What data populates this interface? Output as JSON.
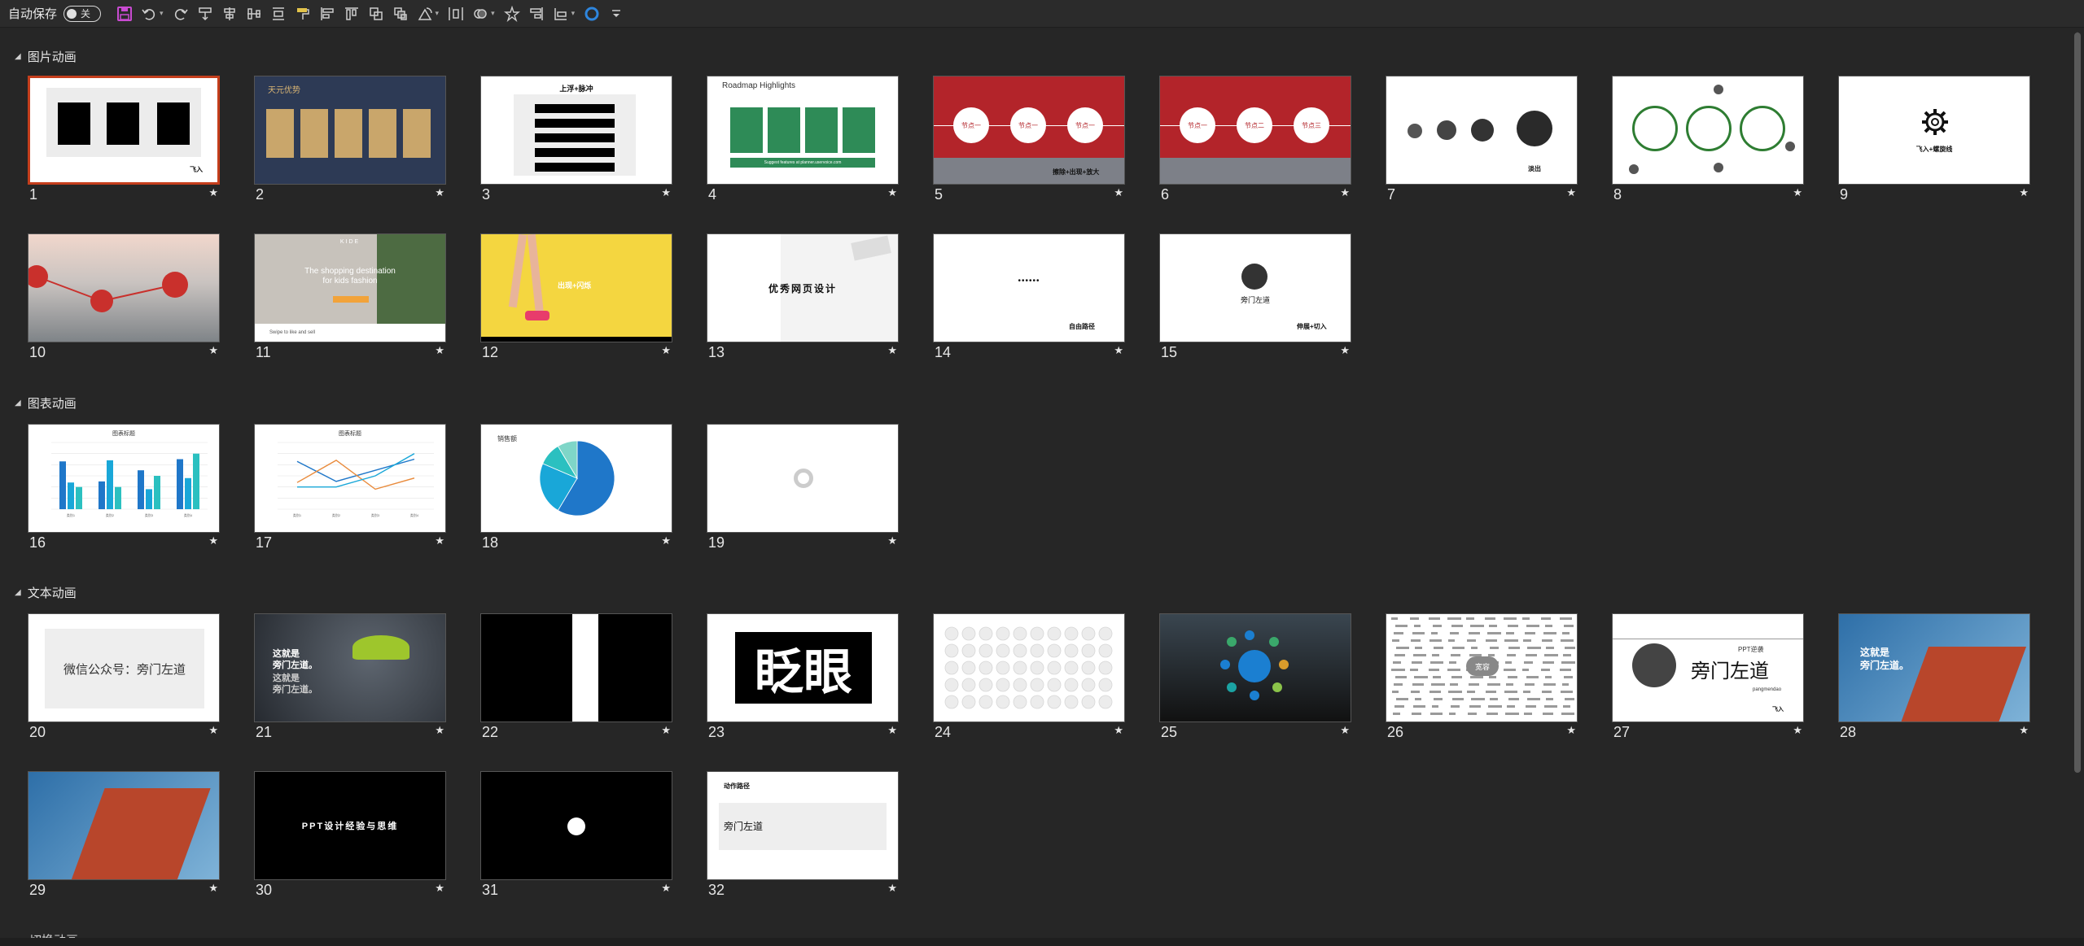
{
  "toolbar": {
    "autosave_label": "自动保存",
    "autosave_state": "关",
    "icons": [
      "save-icon",
      "undo-icon",
      "redo-icon",
      "align-icon",
      "align-center-icon",
      "distribute-icon",
      "align-middle-icon",
      "format-painter-icon",
      "align-left-icon",
      "align-top-icon",
      "group-icon",
      "arrange-icon",
      "rotate-icon",
      "distribute-horizontal-icon",
      "shapes-icon",
      "effects-icon",
      "align-right-icon",
      "align-bottom-icon",
      "color-circle-icon",
      "customize-icon"
    ]
  },
  "sections": [
    {
      "title": "图片动画"
    },
    {
      "title": "图表动画"
    },
    {
      "title": "文本动画"
    }
  ],
  "next_section": "切换动画",
  "slides": {
    "s1": {
      "num": "1",
      "caption": "飞入"
    },
    "s2": {
      "num": "2",
      "title": "天元优势"
    },
    "s3": {
      "num": "3",
      "title": "上浮+脉冲"
    },
    "s4": {
      "num": "4",
      "title": "Roadmap Highlights",
      "footer": "Suggest features at planner.uservoice.com"
    },
    "s5": {
      "num": "5",
      "n1": "节点一",
      "n2": "节点一",
      "n3": "节点一",
      "caption": "擦除+出现+放大"
    },
    "s6": {
      "num": "6",
      "n1": "节点一",
      "n2": "节点二",
      "n3": "节点三"
    },
    "s7": {
      "num": "7",
      "caption": "淡出"
    },
    "s8": {
      "num": "8"
    },
    "s9": {
      "num": "9",
      "caption": "飞入+螺旋线"
    },
    "s10": {
      "num": "10"
    },
    "s11": {
      "num": "11",
      "brand": "KIDE",
      "headline1": "The shopping destination",
      "headline2": "for kids fashion",
      "footer": "Swipe to like and sell"
    },
    "s12": {
      "num": "12",
      "caption": "出现+闪烁"
    },
    "s13": {
      "num": "13",
      "title": "优秀网页设计"
    },
    "s14": {
      "num": "14",
      "dots": "••••••",
      "caption": "自由路径"
    },
    "s15": {
      "num": "15",
      "name": "旁门左道",
      "caption": "伸展+切入"
    },
    "s16": {
      "num": "16",
      "title": "图表标题"
    },
    "s17": {
      "num": "17",
      "title": "图表标题"
    },
    "s18": {
      "num": "18",
      "title": "销售额"
    },
    "s19": {
      "num": "19"
    },
    "s20": {
      "num": "20",
      "text": "微信公众号：旁门左道"
    },
    "s21": {
      "num": "21",
      "l1": "这就是",
      "l2": "旁门左道。",
      "l3": "这就是",
      "l4": "旁门左道。"
    },
    "s22": {
      "num": "22"
    },
    "s23": {
      "num": "23",
      "text": "眨眼"
    },
    "s24": {
      "num": "24"
    },
    "s25": {
      "num": "25"
    },
    "s26": {
      "num": "26",
      "center": "宽容"
    },
    "s27": {
      "num": "27",
      "title": "PPT逆袭",
      "name": "旁门左道",
      "sub": "pangmendao",
      "caption": "飞入"
    },
    "s28": {
      "num": "28",
      "l1": "这就是",
      "l2": "旁门左道。"
    },
    "s29": {
      "num": "29"
    },
    "s30": {
      "num": "30",
      "text": "PPT设计经验与思维"
    },
    "s31": {
      "num": "31"
    },
    "s32": {
      "num": "32",
      "title": "动作路径",
      "text": "旁门左道"
    }
  },
  "colors": {
    "selected_border": "#c43e1c",
    "bg": "#262626",
    "star": "#e6e6e6"
  },
  "chart_data": [
    {
      "type": "bar",
      "title": "图表标题",
      "categories": [
        "类别1",
        "类别2",
        "类别3",
        "类别4"
      ],
      "series": [
        {
          "values": [
            4.3,
            2.5,
            3.5,
            4.5
          ]
        },
        {
          "values": [
            2.4,
            4.4,
            1.8,
            2.8
          ]
        },
        {
          "values": [
            2.0,
            2.0,
            3.0,
            5.0
          ]
        }
      ],
      "ylim": [
        0,
        6
      ]
    },
    {
      "type": "line",
      "title": "图表标题",
      "categories": [
        "类别1",
        "类别2",
        "类别3",
        "类别4"
      ],
      "series": [
        {
          "values": [
            4.3,
            2.5,
            3.5,
            4.5
          ]
        },
        {
          "values": [
            2.4,
            4.4,
            1.8,
            2.8
          ]
        },
        {
          "values": [
            2.0,
            2.0,
            3.0,
            5.0
          ]
        }
      ],
      "ylim": [
        0,
        6
      ]
    },
    {
      "type": "pie",
      "title": "销售额",
      "values": [
        8.2,
        3.2,
        1.4,
        1.2
      ]
    }
  ]
}
